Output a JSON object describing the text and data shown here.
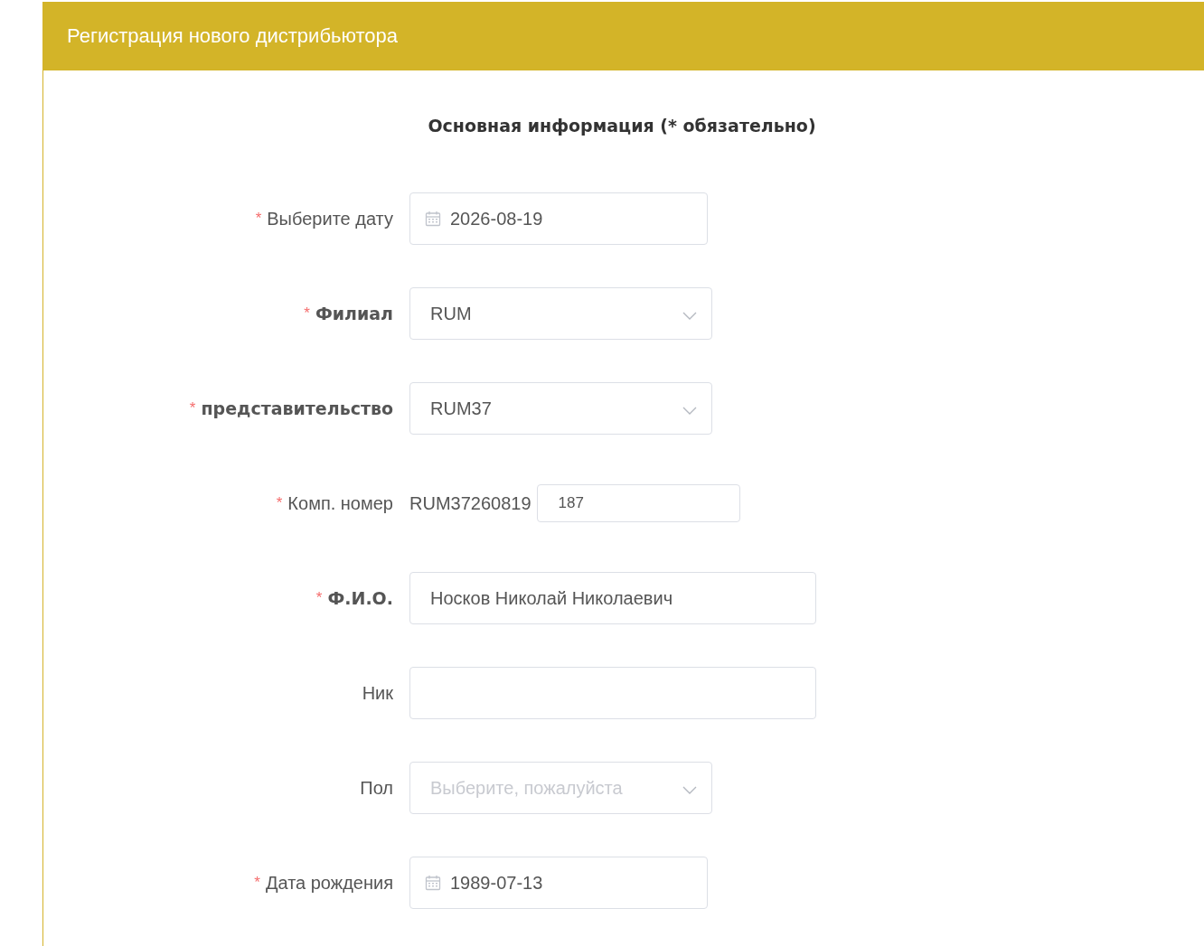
{
  "header": {
    "title": "Регистрация нового дистрибьютора"
  },
  "section_title": "Основная информация (* обязательно)",
  "fields": [
    {
      "kind": "date",
      "label": "Выберите дату",
      "required_mark": "*",
      "emphasized": false,
      "value": "2026-08-19"
    },
    {
      "kind": "select",
      "label": "Филиал",
      "required_mark": "*",
      "emphasized": true,
      "value": "RUM"
    },
    {
      "kind": "select",
      "label": "представительство",
      "required_mark": "*",
      "emphasized": true,
      "value": "RUM37"
    },
    {
      "kind": "compound",
      "label": "Комп. номер",
      "required_mark": "*",
      "emphasized": false,
      "prefix": "RUM37260819",
      "value": "187"
    },
    {
      "kind": "text",
      "label": "Ф.И.О.",
      "required_mark": "*",
      "emphasized": true,
      "value": "Носков Николай Николаевич"
    },
    {
      "kind": "text",
      "label": "Ник",
      "emphasized": false
    },
    {
      "kind": "select",
      "label": "Пол",
      "emphasized": false,
      "placeholder": "Выберите, пожалуйста"
    },
    {
      "kind": "date",
      "label": "Дата рождения",
      "required_mark": "*",
      "emphasized": false,
      "value": "1989-07-13"
    }
  ]
}
